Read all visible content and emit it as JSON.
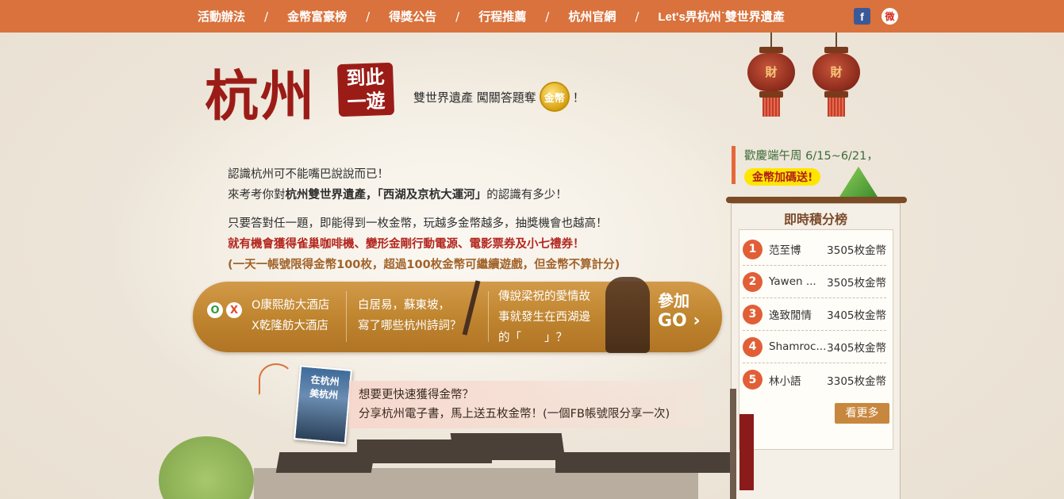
{
  "nav": {
    "links": [
      "活動辦法",
      "金幣富豪榜",
      "得獎公告",
      "行程推薦",
      "杭州官網",
      "Let's畀杭州˙雙世界遺產"
    ],
    "separator": "/",
    "facebook_icon": "f",
    "weibo_icon": "微"
  },
  "logo": {
    "main": "杭州",
    "seal_line1": "到此",
    "seal_line2": "一遊"
  },
  "tagline": {
    "text": "雙世界遺產 闖關答題奪",
    "coin_label": "金幣",
    "suffix": "！"
  },
  "lanterns": {
    "char": "財"
  },
  "intro": {
    "line1": "認識杭州可不能嘴巴說說而已！",
    "line2_prefix": "來考考你對",
    "line2_bold": "杭州雙世界遺產，「西湖及京杭大運河」",
    "line2_suffix": "的認識有多少！",
    "line3": "只要答對任一題，即能得到一枚金幣，玩越多金幣越多，抽獎機會也越高！",
    "line4": "就有機會獲得雀巢咖啡機、變形金剛行動電源、電影票券及小七禮券！",
    "line5": "(一天一帳號限得金幣100枚，超過100枚金幣可繼續遊戲，但金幣不算計分)"
  },
  "quiz": {
    "flag_o": "O",
    "flag_x": "X",
    "q1_line1": "O康熙舫大酒店",
    "q1_line2": "X乾隆舫大酒店",
    "q2_line1": "白居易，蘇東坡，",
    "q2_line2": "寫了哪些杭州詩詞？",
    "q3_line1": "傳說梁祝的愛情故",
    "q3_line2": "事就發生在西湖邊",
    "q3_line3": "的「　　」？",
    "go_line1": "參加",
    "go_line2": "GO",
    "go_arrow": "›"
  },
  "share": {
    "ebook_title": "在杭州\n美杭州",
    "line1": "想要更快速獲得金幣？",
    "line2": "分享杭州電子書，馬上送五枚金幣！(一個FB帳號限分享一次)"
  },
  "promo": {
    "title": "歡慶端午周 6/15~6/21，",
    "badge": "金幣加碼送!"
  },
  "leaderboard": {
    "title": "即時積分榜",
    "rows": [
      {
        "rank": "1",
        "name": "范至博",
        "score": "3505枚金幣"
      },
      {
        "rank": "2",
        "name": "Yawen ...",
        "score": "3505枚金幣"
      },
      {
        "rank": "3",
        "name": "逸致閒情",
        "score": "3405枚金幣"
      },
      {
        "rank": "4",
        "name": "Shamroc...",
        "score": "3405枚金幣"
      },
      {
        "rank": "5",
        "name": "林小語",
        "score": "3305枚金幣"
      }
    ],
    "more_label": "看更多"
  },
  "colors": {
    "nav_bg": "#d9723c",
    "accent_red": "#9b1c17",
    "quiz_gold": "#c0852f",
    "rank_orange": "#e15f37",
    "badge_yellow": "#ffe600"
  }
}
